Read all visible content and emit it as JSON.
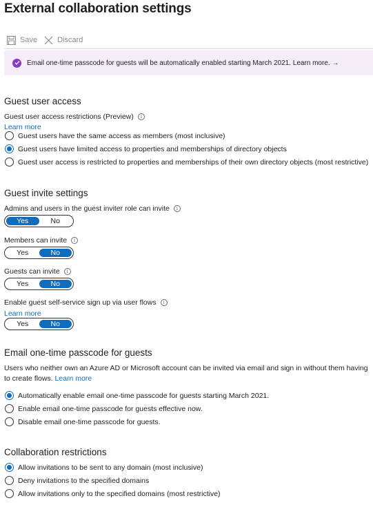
{
  "page": {
    "title": "External collaboration settings"
  },
  "toolbar": {
    "save_label": "Save",
    "discard_label": "Discard"
  },
  "banner": {
    "text": "Email one-time passcode for guests will be automatically enabled starting March 2021. Learn more. →"
  },
  "guest_access": {
    "title": "Guest user access",
    "restrictions_label": "Guest user access restrictions (Preview)",
    "learn_more": "Learn more",
    "options": [
      {
        "label": "Guest users have the same access as members (most inclusive)",
        "selected": false
      },
      {
        "label": "Guest users have limited access to properties and memberships of directory objects",
        "selected": true
      },
      {
        "label": "Guest user access is restricted to properties and memberships of their own directory objects (most restrictive)",
        "selected": false
      }
    ]
  },
  "invite_settings": {
    "title": "Guest invite settings",
    "toggles": [
      {
        "label": "Admins and users in the guest inviter role can invite",
        "yes": "Yes",
        "no": "No",
        "value": "Yes"
      },
      {
        "label": "Members can invite",
        "yes": "Yes",
        "no": "No",
        "value": "No"
      },
      {
        "label": "Guests can invite",
        "yes": "Yes",
        "no": "No",
        "value": "No"
      },
      {
        "label": "Enable guest self-service sign up via user flows",
        "yes": "Yes",
        "no": "No",
        "value": "No",
        "learn_more": "Learn more"
      }
    ]
  },
  "otp": {
    "title": "Email one-time passcode for guests",
    "description": "Users who neither own an Azure AD or Microsoft account can be invited via email and sign in without them having to create flows.",
    "learn_more": "Learn more",
    "options": [
      {
        "label": "Automatically enable email one-time passcode for guests starting March 2021.",
        "selected": true
      },
      {
        "label": "Enable email one-time passcode for guests effective now.",
        "selected": false
      },
      {
        "label": "Disable email one-time passcode for guests.",
        "selected": false
      }
    ]
  },
  "collab": {
    "title": "Collaboration restrictions",
    "options": [
      {
        "label": "Allow invitations to be sent to any domain (most inclusive)",
        "selected": true
      },
      {
        "label": "Deny invitations to the specified domains",
        "selected": false
      },
      {
        "label": "Allow invitations only to the specified domains (most restrictive)",
        "selected": false
      }
    ]
  },
  "colors": {
    "accent": "#0f6cbd",
    "banner_bg": "#f5eef9",
    "banner_icon": "#8a3ac2"
  },
  "icons": {
    "save": "save-icon",
    "discard": "close-icon",
    "banner": "info-badge-icon",
    "info": "info-icon"
  }
}
